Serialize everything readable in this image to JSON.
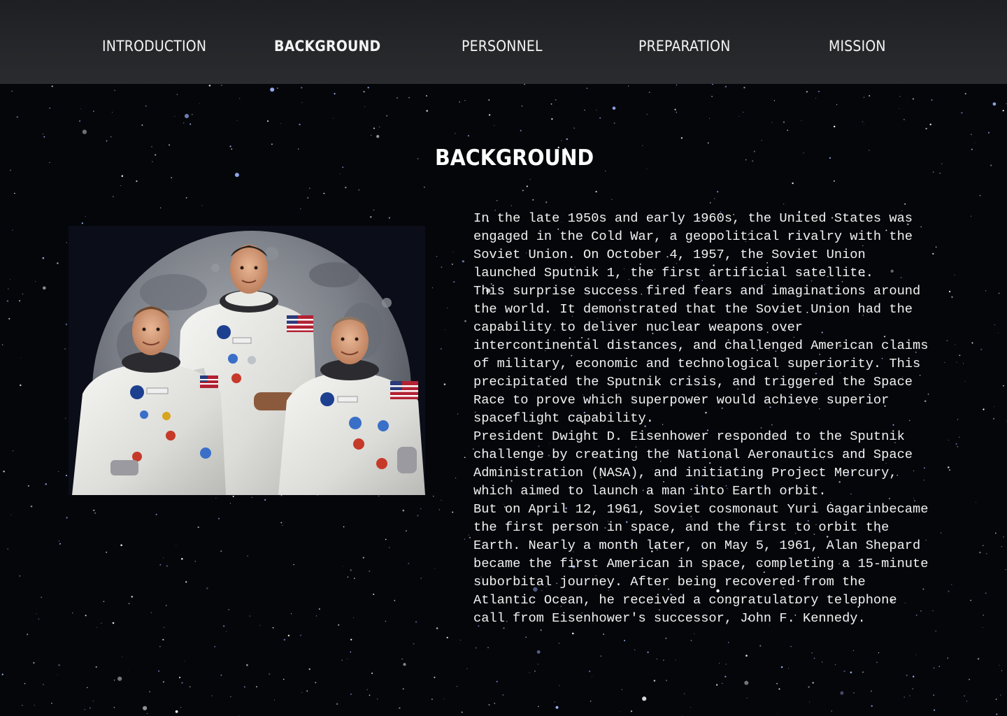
{
  "nav": {
    "items": [
      {
        "label": "INTRODUCTION",
        "active": false
      },
      {
        "label": "BACKGROUND",
        "active": true
      },
      {
        "label": "PERSONNEL",
        "active": false
      },
      {
        "label": "PREPARATION",
        "active": false
      },
      {
        "label": "MISSION",
        "active": false
      }
    ]
  },
  "page": {
    "title": "BACKGROUND"
  },
  "photo": {
    "subject": "three astronauts in white spacesuits posed in front of the Moon",
    "icons": [
      "nasa-logo",
      "us-flag"
    ]
  },
  "body": {
    "paragraphs": [
      "In the late 1950s and early 1960s, the United States was\nengaged in the Cold War, a geopolitical rivalry with the\nSoviet Union. On October 4, 1957, the Soviet Union\nlaunched Sputnik 1, the first artificial satellite.",
      "This surprise success fired fears and imaginations around\nthe world. It demonstrated that the Soviet Union had the\ncapability to deliver nuclear weapons over\nintercontinental distances, and challenged American claims\nof military, economic and technological superiority. This\nprecipitated the Sputnik crisis, and triggered the Space\nRace to prove which superpower would achieve superior\nspaceflight capability.",
      "President Dwight D. Eisenhower responded to the Sputnik\nchallenge by creating the National Aeronautics and Space\nAdministration (NASA), and initiating Project Mercury,\nwhich aimed to launch a man into Earth orbit.",
      "But on April 12, 1961, Soviet cosmonaut Yuri Gagarinbecame\nthe first person in space, and the first to orbit the\nEarth. Nearly a month later, on May 5, 1961, Alan Shepard\nbecame the first American in space, completing a 15-minute\nsuborbital journey. After being recovered from the\nAtlantic Ocean, he received a congratulatory telephone\ncall from Eisenhower's successor, John F. Kennedy."
    ]
  },
  "colors": {
    "background": "#05060a",
    "nav_bar": "#26272a",
    "text": "#f2f2f2",
    "star": "#ffffff",
    "star_blue": "#9fb6ff"
  }
}
